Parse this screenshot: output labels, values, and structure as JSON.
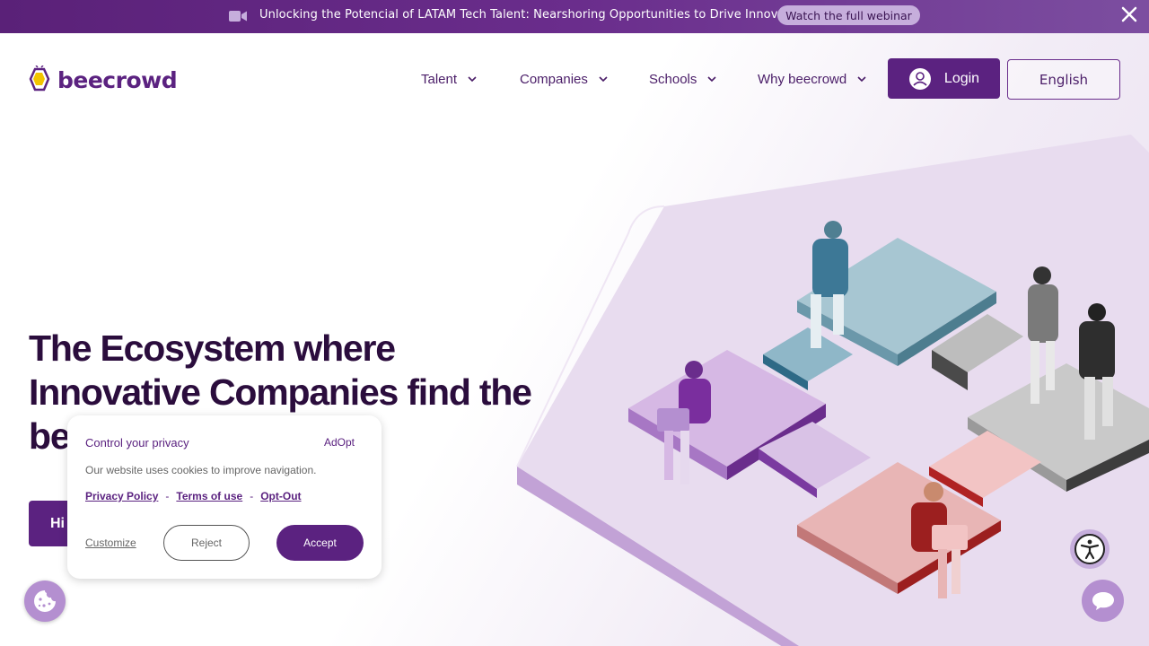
{
  "banner": {
    "text": "Unlocking the Potencial of LATAM Tech Talent: Nearshoring Opportunities to Drive Innovation",
    "button_label": "Watch the full webinar",
    "icon": "video-camera-icon"
  },
  "header": {
    "logo_text": "beecrowd",
    "nav": [
      {
        "label": "Talent"
      },
      {
        "label": "Companies"
      },
      {
        "label": "Schools"
      },
      {
        "label": "Why beecrowd"
      }
    ],
    "login_label": "Login",
    "language_label": "English"
  },
  "hero": {
    "title_line1": "The Ecosystem where",
    "title_line2": "Innovative Companies find the",
    "title_line3_visible": "be",
    "cta_visible": "Hi"
  },
  "cookie_popup": {
    "title": "Control your privacy",
    "brand": "AdOpt",
    "description": "Our website uses cookies to improve navigation.",
    "links": [
      "Privacy Policy",
      "Terms of use",
      "Opt-Out"
    ],
    "separator": "-",
    "customize_label": "Customize",
    "reject_label": "Reject",
    "accept_label": "Accept"
  },
  "colors": {
    "brand_purple": "#5b2280",
    "banner_bg": "#6a2d8c",
    "heading": "#2b0d3d",
    "accent_light": "#c6aedc"
  }
}
